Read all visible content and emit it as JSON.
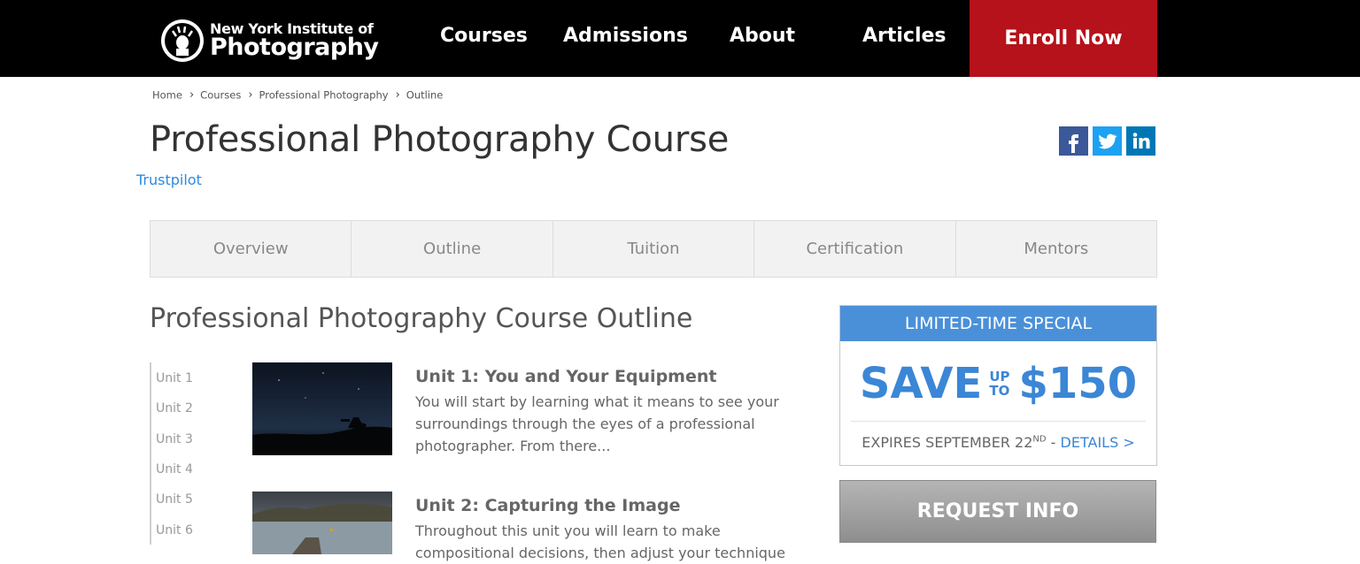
{
  "header": {
    "logo_line1": "New York Institute of",
    "logo_line2": "Photography",
    "nav": [
      "Courses",
      "Admissions",
      "About",
      "Articles"
    ],
    "enroll_label": "Enroll Now"
  },
  "breadcrumb": [
    "Home",
    "Courses",
    "Professional Photography",
    "Outline"
  ],
  "page_title": "Professional Photography Course",
  "trustpilot": "Trustpilot",
  "social": [
    "facebook-icon",
    "twitter-icon",
    "linkedin-icon"
  ],
  "tabs": [
    "Overview",
    "Outline",
    "Tuition",
    "Certification",
    "Mentors"
  ],
  "outline_title": "Professional Photography Course Outline",
  "unit_nav": [
    "Unit 1",
    "Unit 2",
    "Unit 3",
    "Unit 4",
    "Unit 5",
    "Unit 6"
  ],
  "units": [
    {
      "title": "Unit 1: You and Your Equipment",
      "desc": "You will start by learning what it means to see your surroundings through the eyes of a professional photographer. From there..."
    },
    {
      "title": "Unit 2: Capturing the Image",
      "desc": "Throughout this unit you will learn to make compositional decisions, then adjust your technique"
    }
  ],
  "special": {
    "header": "LIMITED-TIME SPECIAL",
    "save": "SAVE",
    "up": "UP",
    "to": "TO",
    "amount": "$150",
    "expires": "EXPIRES SEPTEMBER 22",
    "expires_sup": "ND",
    "dash": " - ",
    "details": "DETAILS >"
  },
  "request_label": "REQUEST INFO",
  "colors": {
    "header_bg": "#000000",
    "enroll_bg": "#b5121b",
    "accent_blue": "#4a90d9",
    "facebook": "#3b5998",
    "twitter": "#1da1f2",
    "linkedin": "#0077b5"
  }
}
